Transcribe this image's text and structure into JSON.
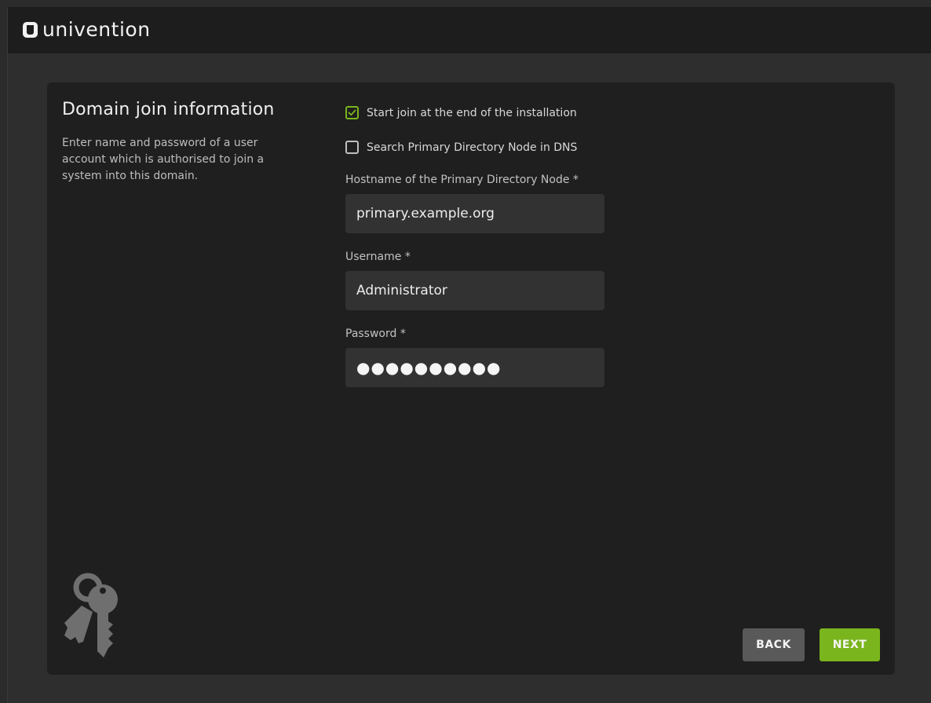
{
  "app": {
    "logo_text": "univention",
    "logo_icon": "univention-logo-icon"
  },
  "page": {
    "title": "Domain join information",
    "description": "Enter name and password of a user account which is authorised to join a system into this domain.",
    "illustration_icon": "keys-icon"
  },
  "form": {
    "start_join": {
      "label": "Start join at the end of the installation",
      "checked": true
    },
    "search_dns": {
      "label": "Search Primary Directory Node in DNS",
      "checked": false
    },
    "hostname": {
      "label": "Hostname of the Primary Directory Node *",
      "value": "primary.example.org"
    },
    "username": {
      "label": "Username *",
      "value": "Administrator"
    },
    "password": {
      "label": "Password *",
      "masked_value": "●●●●●●●●●●"
    }
  },
  "buttons": {
    "back": "BACK",
    "next": "NEXT"
  },
  "colors": {
    "accent": "#7ab51d",
    "panel": "#1f1f1f",
    "topbar": "#1d1d1d",
    "input_bg": "#323232",
    "back_button": "#595959"
  }
}
